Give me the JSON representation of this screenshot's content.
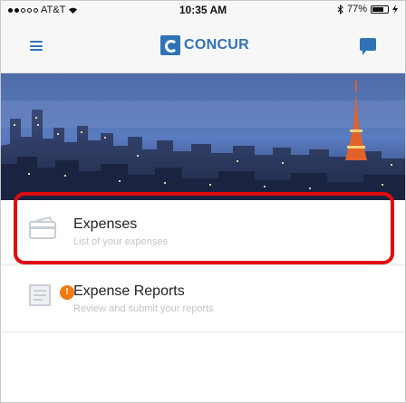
{
  "status_bar": {
    "carrier": "AT&T",
    "time": "10:35 AM",
    "battery_percent": "77%",
    "battery_level": 0.77
  },
  "nav": {
    "logo_text": "CONCUR",
    "left_icon": "menu-icon",
    "right_icon": "chat-icon"
  },
  "colors": {
    "brand": "#2f72b6",
    "badge": "#f07b0e",
    "highlight": "#e00b0b"
  },
  "list": {
    "items": [
      {
        "title": "Expenses",
        "subtitle": "List of your expenses",
        "icon": "credit-card-icon"
      },
      {
        "title": "Expense Reports",
        "subtitle": "Review and submit your reports",
        "icon": "report-icon",
        "badge": "!"
      }
    ]
  }
}
